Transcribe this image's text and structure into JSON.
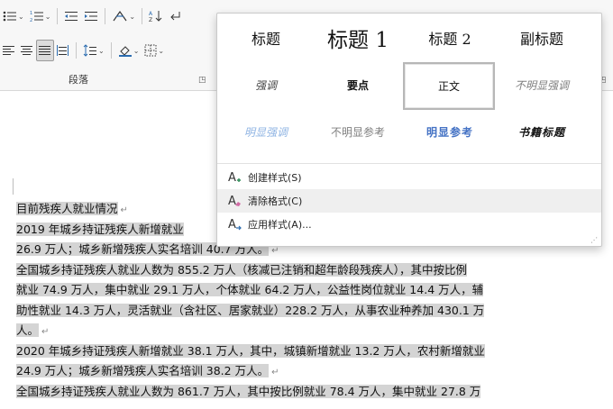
{
  "ribbon": {
    "group_label": "段落",
    "launcher_icon": "dialog-launcher-icon",
    "row1": [
      "bullets-icon",
      "numbering-icon",
      "decrease-indent-icon",
      "increase-indent-icon",
      "chinese-layout-icon",
      "sort-icon",
      "show-marks-icon"
    ],
    "row2": [
      "align-left-icon",
      "align-center-icon",
      "justify-icon",
      "distributed-icon",
      "line-spacing-icon",
      "shading-icon",
      "borders-icon"
    ]
  },
  "gallery": {
    "styles_row1": [
      {
        "label": "标题",
        "style": "heading"
      },
      {
        "label": "标题 1",
        "style": "heading1"
      },
      {
        "label": "标题 2",
        "style": "heading2"
      },
      {
        "label": "副标题",
        "style": "subtitle"
      }
    ],
    "styles_row2": [
      {
        "label": "强调",
        "style": "emphasis"
      },
      {
        "label": "要点",
        "style": "strong"
      },
      {
        "label": "正文",
        "style": "normal",
        "selected": true
      },
      {
        "label": "不明显强调",
        "style": "subtle-emphasis"
      }
    ],
    "styles_row3": [
      {
        "label": "明显强调",
        "style": "intense-emphasis"
      },
      {
        "label": "不明显参考",
        "style": "subtle-reference"
      },
      {
        "label": "明显参考",
        "style": "intense-reference"
      },
      {
        "label": "书籍标题",
        "style": "book-title"
      }
    ],
    "menu": [
      {
        "label": "创建样式(S)",
        "icon": "create-style-icon"
      },
      {
        "label": "清除格式(C)",
        "icon": "clear-formatting-icon",
        "hover": true
      },
      {
        "label": "应用样式(A)...",
        "icon": "apply-styles-icon"
      }
    ]
  },
  "document": {
    "title_line": "目前残疾人就业情况",
    "p1_line1": "2019 年城乡持证残疾人新增就业",
    "p1_line2": "26.9 万人；城乡新增残疾人实名培训 40.7 万人。",
    "p2_lines": [
      "全国城乡持证残疾人就业人数为 855.2 万人（核减已注销和超年龄段残疾人），其中按比例",
      "就业 74.9 万人，集中就业 29.1 万人，个体就业 64.2 万人，公益性岗位就业 14.4 万人，辅",
      "助性就业 14.3 万人，灵活就业（含社区、居家就业）228.2 万人，从事农业种养加 430.1 万",
      "人。"
    ],
    "p3_lines": [
      "2020 年城乡持证残疾人新增就业 38.1 万人，其中，城镇新增就业 13.2 万人，农村新增就业",
      "24.9 万人；城乡新增残疾人实名培训 38.2 万人。"
    ],
    "p4_line1": "全国城乡持证残疾人就业人数为 861.7 万人，其中按比例就业 78.4 万人，集中就业 27.8 万",
    "para_mark": "↵"
  },
  "colors": {
    "selection": "#d4d4d4",
    "intense_blue": "#4472c4",
    "light_blue": "#8fb4e3",
    "gray_text": "#7f7f7f"
  }
}
